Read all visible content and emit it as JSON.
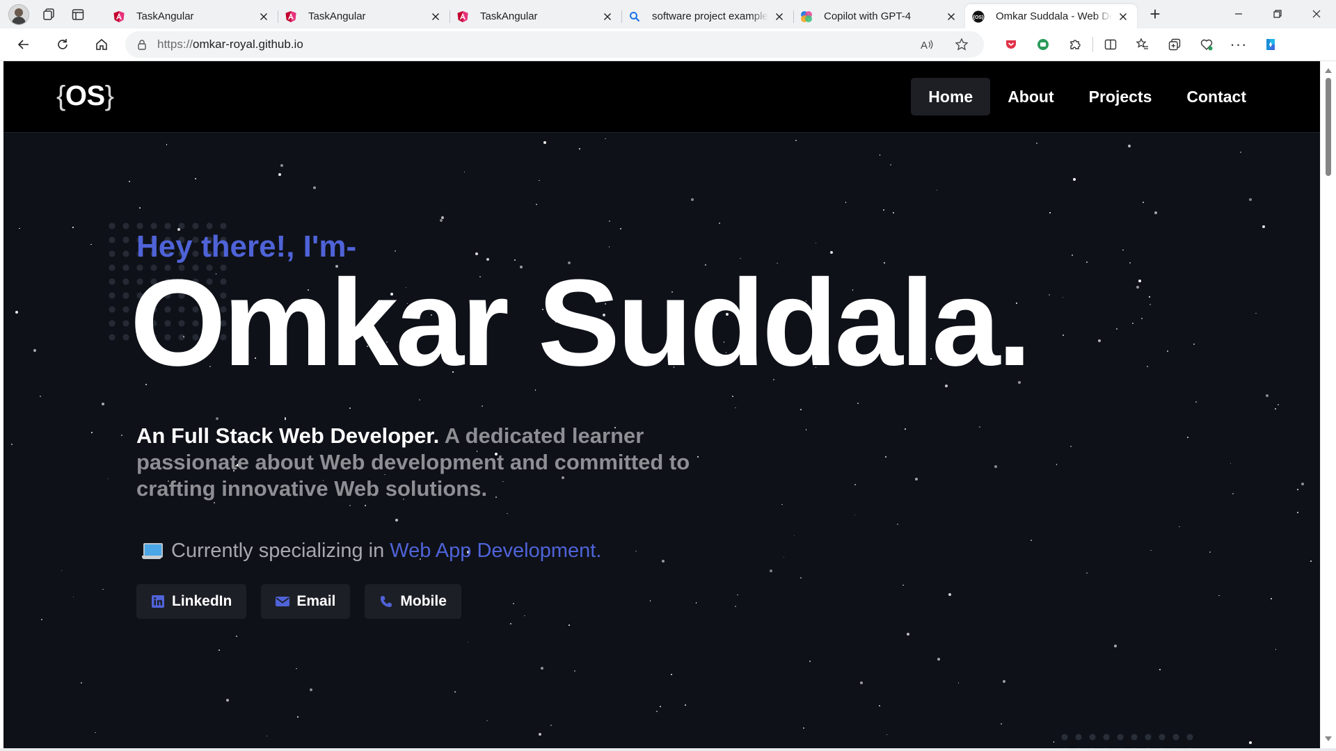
{
  "browser": {
    "tabs": [
      {
        "title": "TaskAngular",
        "icon": "angular-icon",
        "active": false
      },
      {
        "title": "TaskAngular",
        "icon": "angular-icon",
        "active": false
      },
      {
        "title": "TaskAngular",
        "icon": "angular-icon",
        "active": false
      },
      {
        "title": "software project example",
        "icon": "search-icon",
        "active": false
      },
      {
        "title": "Copilot with GPT-4",
        "icon": "copilot-icon",
        "active": false
      },
      {
        "title": "Omkar Suddala - Web Developer",
        "icon": "os-logo-icon",
        "active": true
      }
    ],
    "url_scheme": "https://",
    "url_host": "omkar-royal.github.io"
  },
  "site": {
    "logo_open": "{",
    "logo_text": "OS",
    "logo_close": "}",
    "nav": [
      {
        "label": "Home",
        "active": true
      },
      {
        "label": "About",
        "active": false
      },
      {
        "label": "Projects",
        "active": false
      },
      {
        "label": "Contact",
        "active": false
      }
    ]
  },
  "hero": {
    "greeting": "Hey there!, I'm-",
    "name": "Omkar Suddala.",
    "desc_lead": "An Full Stack Web Developer.",
    "desc_rest": " A dedicated learner passionate about Web development and committed to crafting innovative Web solutions.",
    "spec_prefix": "Currently specializing in",
    "spec_accent": "Web App Development.",
    "buttons": [
      {
        "label": "LinkedIn",
        "icon": "linkedin-icon"
      },
      {
        "label": "Email",
        "icon": "envelope-icon"
      },
      {
        "label": "Mobile",
        "icon": "phone-icon"
      }
    ]
  },
  "colors": {
    "accent": "#4f63d8",
    "page_bg": "#0e1118",
    "nav_bg": "#000000",
    "button_bg": "#1d1f26"
  }
}
